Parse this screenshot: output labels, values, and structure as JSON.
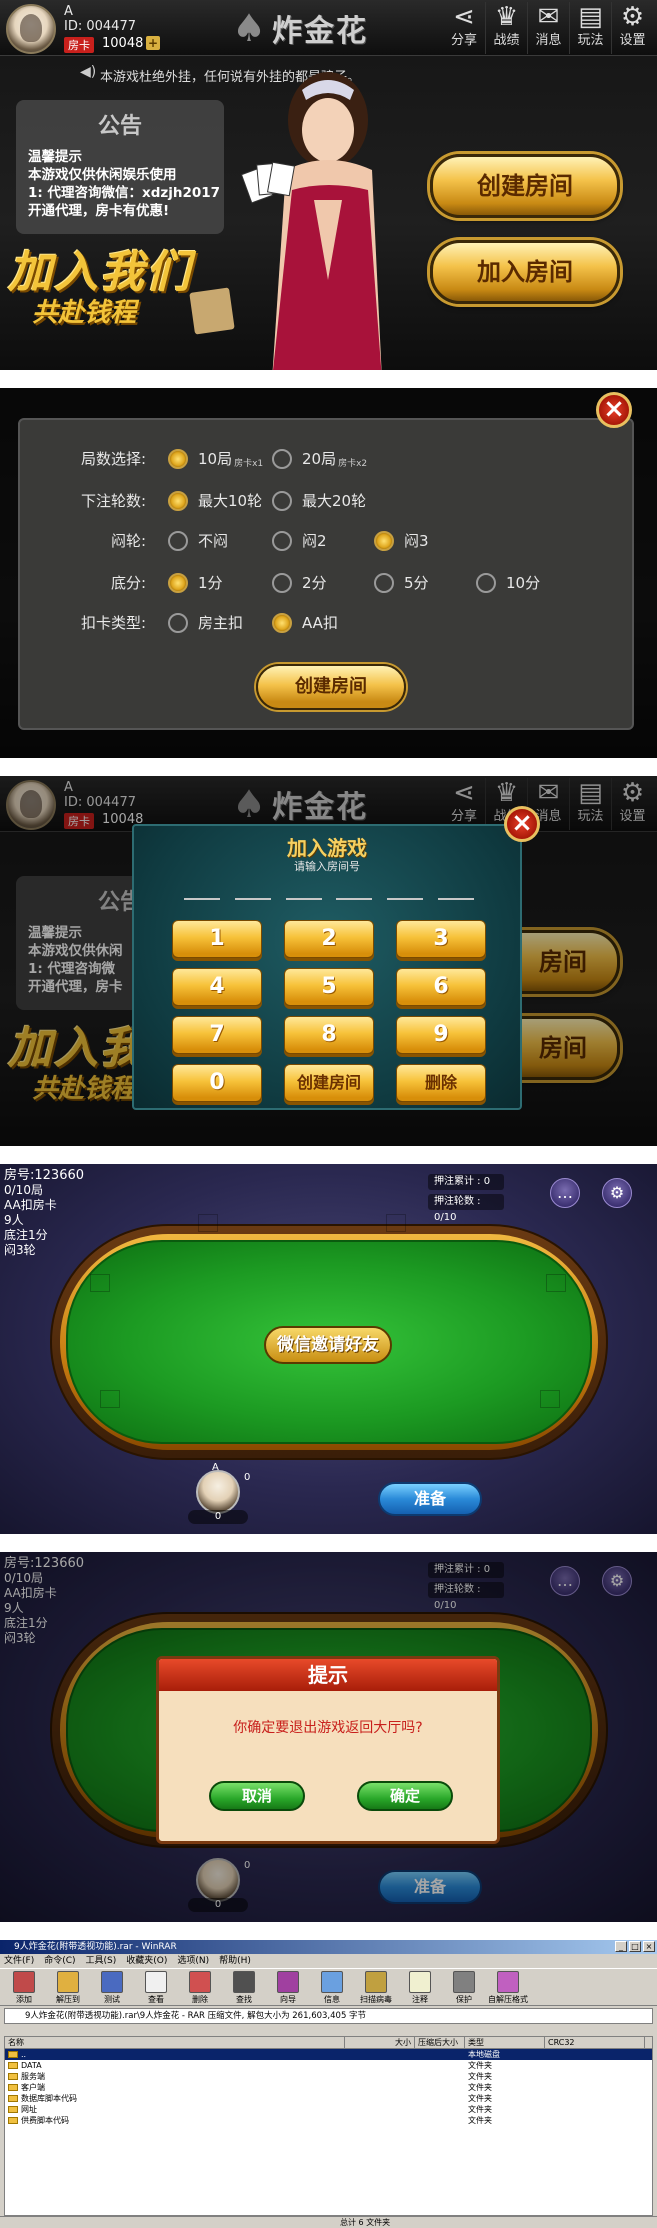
{
  "lobby": {
    "user_name": "A",
    "user_id": "ID: 004477",
    "room_card_label": "房卡",
    "room_card_count": "10048",
    "plus": "+",
    "logo_text": "炸金花",
    "nav": [
      {
        "icon": "share-icon",
        "glyph": "⋖",
        "label": "分享"
      },
      {
        "icon": "crown-icon",
        "glyph": "♛",
        "label": "战绩"
      },
      {
        "icon": "mail-icon",
        "glyph": "✉",
        "label": "消息"
      },
      {
        "icon": "document-icon",
        "glyph": "▤",
        "label": "玩法"
      },
      {
        "icon": "gear-icon",
        "glyph": "⚙",
        "label": "设置"
      }
    ],
    "marquee": "本游戏杜绝外挂，任何说有外挂的都是骗子。",
    "notice_title": "公告",
    "notice_lines": [
      "温馨提示",
      "本游戏仅供休闲娱乐使用",
      "1: 代理咨询微信：xdzjh2017",
      "开通代理，房卡有优惠!"
    ],
    "join_us_big": "加入我们",
    "join_us_small": "共赴钱程",
    "create_room": "创建房间",
    "join_room": "加入房间"
  },
  "settings": {
    "rows": [
      {
        "label": "局数选择:",
        "options": [
          {
            "text": "10局",
            "sub": "房卡x1",
            "on": true
          },
          {
            "text": "20局",
            "sub": "房卡x2",
            "on": false
          }
        ]
      },
      {
        "label": "下注轮数:",
        "options": [
          {
            "text": "最大10轮",
            "on": true
          },
          {
            "text": "最大20轮",
            "on": false
          }
        ]
      },
      {
        "label": "闷轮:",
        "options": [
          {
            "text": "不闷",
            "on": false
          },
          {
            "text": "闷2",
            "on": false
          },
          {
            "text": "闷3",
            "on": true
          }
        ]
      },
      {
        "label": "底分:",
        "options": [
          {
            "text": "1分",
            "on": true
          },
          {
            "text": "2分",
            "on": false
          },
          {
            "text": "5分",
            "on": false
          },
          {
            "text": "10分",
            "on": false
          }
        ]
      },
      {
        "label": "扣卡类型:",
        "options": [
          {
            "text": "房主扣",
            "on": false
          },
          {
            "text": "AA扣",
            "on": true
          }
        ]
      }
    ],
    "create_button": "创建房间",
    "close": "×"
  },
  "join": {
    "title": "加入游戏",
    "subtitle": "请输入房间号",
    "keys": [
      "1",
      "2",
      "3",
      "4",
      "5",
      "6",
      "7",
      "8",
      "9",
      "0",
      "创建房间",
      "删除"
    ],
    "close": "×",
    "bg_notice_lines": [
      "温馨提示",
      "本游戏仅供休闲",
      "1: 代理咨询微",
      "开通代理，房卡"
    ],
    "bg_join_big": "加入我",
    "bg_join_small": "共赴钱程",
    "bg_btn_text": "房间"
  },
  "table": {
    "room_no": "房号:123660",
    "round": "0/10局",
    "card_type": "AA扣房卡",
    "players": "9人",
    "base": "底注1分",
    "men": "闷3轮",
    "bet_total": "押注累计 : 0",
    "bet_rounds": "押注轮数 : 0/10",
    "invite": "微信邀请好友",
    "ready": "准备",
    "player_name": "A",
    "player_cards": "0",
    "player_score": "0",
    "chat_icon": "…",
    "settings_icon": "⚙"
  },
  "confirm": {
    "title": "提示",
    "message": "你确定要退出游戏返回大厅吗?",
    "cancel": "取消",
    "ok": "确定"
  },
  "winrar": {
    "title": "9人炸金花(附带透视功能).rar - WinRAR",
    "menu": [
      "文件(F)",
      "命令(C)",
      "工具(S)",
      "收藏夹(O)",
      "选项(N)",
      "帮助(H)"
    ],
    "toolbar": [
      "添加",
      "解压到",
      "测试",
      "查看",
      "删除",
      "查找",
      "向导",
      "信息",
      "扫描病毒",
      "注释",
      "保护",
      "自解压格式"
    ],
    "path": "9人炸金花(附带透视功能).rar\\9人炸金花 - RAR 压缩文件, 解包大小为 261,603,405 字节",
    "columns": [
      "名称",
      "大小",
      "压缩后大小",
      "类型",
      "CRC32"
    ],
    "rows": [
      {
        "name": "..",
        "type": "本地磁盘"
      },
      {
        "name": "DATA",
        "type": "文件夹"
      },
      {
        "name": "服务端",
        "type": "文件夹"
      },
      {
        "name": "客户端",
        "type": "文件夹"
      },
      {
        "name": "数据库脚本代码",
        "type": "文件夹"
      },
      {
        "name": "网址",
        "type": "文件夹"
      },
      {
        "name": "供费脚本代码",
        "type": "文件夹"
      }
    ],
    "status": "总计 6 文件夹"
  }
}
